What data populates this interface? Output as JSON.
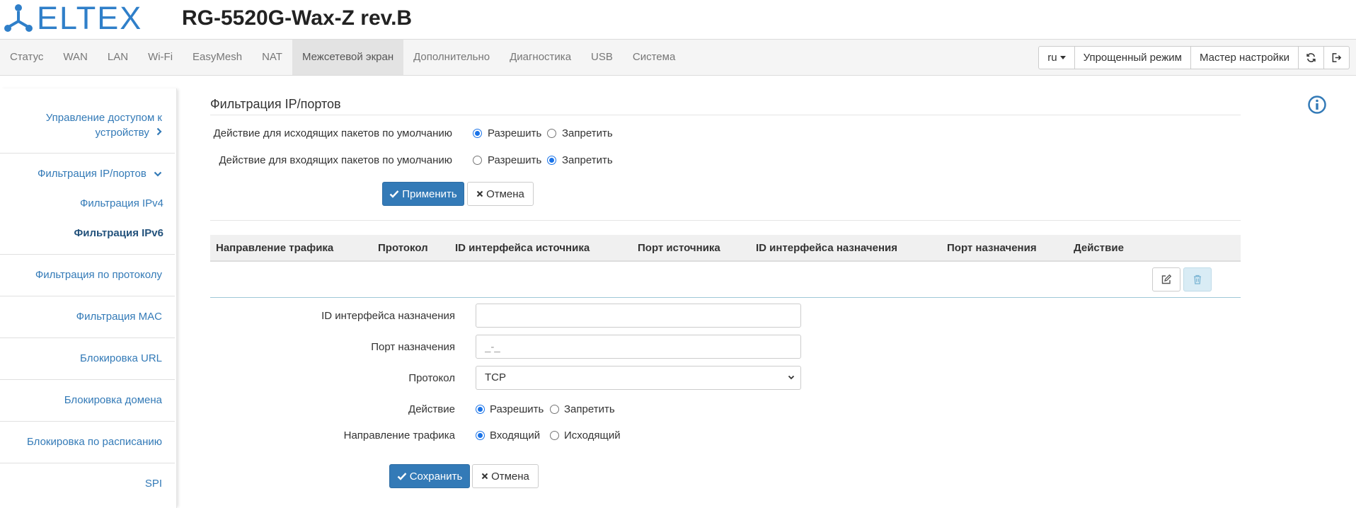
{
  "header": {
    "logo_text": "ELTEX",
    "device_title": "RG-5520G-Wax-Z rev.B"
  },
  "nav": {
    "items": [
      {
        "label": "Статус",
        "key": "status"
      },
      {
        "label": "WAN",
        "key": "wan"
      },
      {
        "label": "LAN",
        "key": "lan"
      },
      {
        "label": "Wi-Fi",
        "key": "wifi"
      },
      {
        "label": "EasyMesh",
        "key": "easymesh"
      },
      {
        "label": "NAT",
        "key": "nat"
      },
      {
        "label": "Межсетевой экран",
        "key": "firewall",
        "active": true
      },
      {
        "label": "Дополнительно",
        "key": "advanced"
      },
      {
        "label": "Диагностика",
        "key": "diagnostics"
      },
      {
        "label": "USB",
        "key": "usb"
      },
      {
        "label": "Система",
        "key": "system"
      }
    ],
    "lang": "ru",
    "simple_mode": "Упрощенный режим",
    "wizard": "Мастер настройки",
    "refresh_icon": "refresh-icon",
    "logout_icon": "logout-icon"
  },
  "sidebar": {
    "access_control_line1": "Управление доступом к",
    "access_control_line2": "устройству",
    "ip_port_filter": "Фильтрация IP/портов",
    "ipv4_filter": "Фильтрация IPv4",
    "ipv6_filter": "Фильтрация IPv6",
    "protocol_filter": "Фильтрация по протоколу",
    "mac_filter": "Фильтрация MAC",
    "url_block": "Блокировка URL",
    "domain_block": "Блокировка домена",
    "schedule_block": "Блокировка по расписанию",
    "spi": "SPI"
  },
  "content": {
    "title": "Фильтрация IP/портов",
    "outgoing_label": "Действие для исходящих пакетов по умолчанию",
    "incoming_label": "Действие для входящих пакетов по умолчанию",
    "allow": "Разрешить",
    "deny": "Запретить",
    "outgoing_value": "allow",
    "incoming_value": "deny",
    "apply_btn": "Применить",
    "cancel_btn": "Отмена"
  },
  "table": {
    "columns": [
      "Направление трафика",
      "Протокол",
      "ID интерфейса источника",
      "Порт источника",
      "ID интерфейса назначения",
      "Порт назначения",
      "Действие"
    ]
  },
  "form": {
    "dest_iface_label": "ID интерфейса назначения",
    "dest_iface_value": "",
    "dest_port_label": "Порт назначения",
    "dest_port_placeholder": "_-_",
    "protocol_label": "Протокол",
    "protocol_value": "TCP",
    "action_label": "Действие",
    "action_allow": "Разрешить",
    "action_deny": "Запретить",
    "action_value": "allow",
    "direction_label": "Направление трафика",
    "direction_in": "Входящий",
    "direction_out": "Исходящий",
    "direction_value": "in",
    "save_btn": "Сохранить",
    "cancel_btn": "Отмена"
  },
  "colors": {
    "brand": "#2f7fc9",
    "primary": "#337ab7",
    "link": "#337ab7",
    "link_active": "#23527c"
  }
}
